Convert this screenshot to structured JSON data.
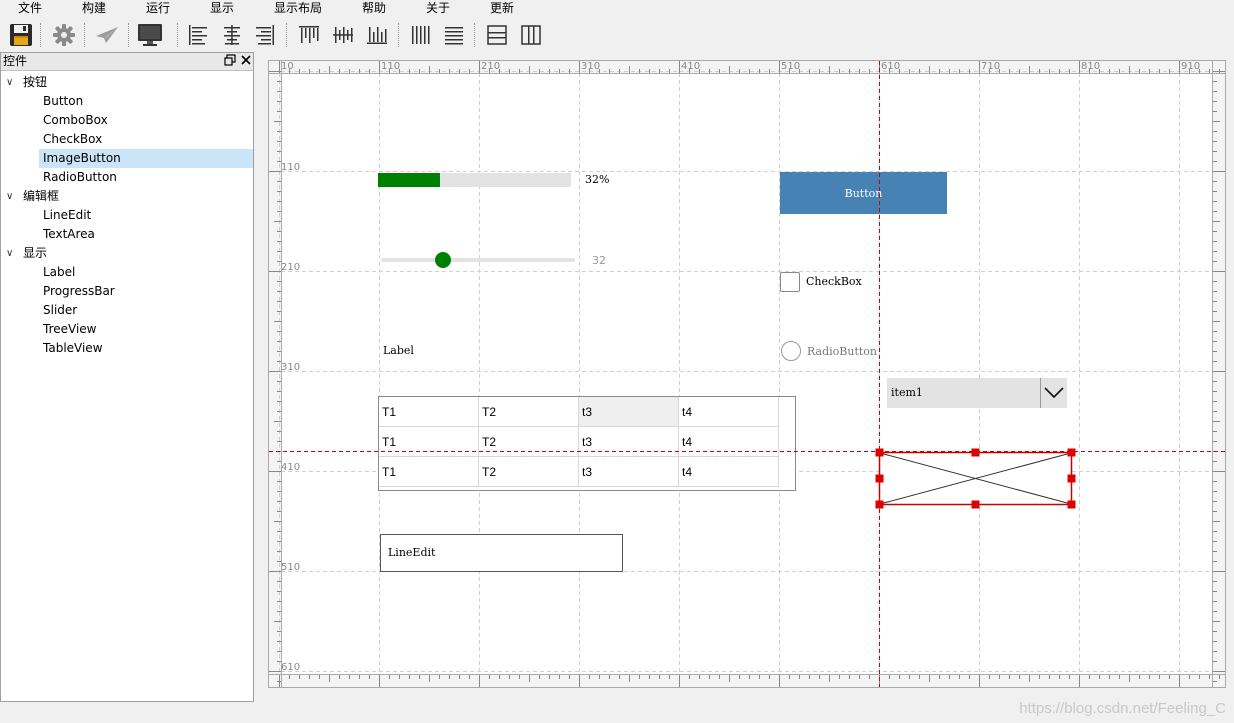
{
  "menu": [
    "文件",
    "构建",
    "运行",
    "显示",
    "显示布局",
    "帮助",
    "关于",
    "更新"
  ],
  "panel": {
    "title": "控件",
    "groups": [
      {
        "label": "按钮",
        "items": [
          "Button",
          "ComboBox",
          "CheckBox",
          "ImageButton",
          "RadioButton"
        ]
      },
      {
        "label": "编辑框",
        "items": [
          "LineEdit",
          "TextArea"
        ]
      },
      {
        "label": "显示",
        "items": [
          "Label",
          "ProgressBar",
          "Slider",
          "TreeView",
          "TableView"
        ]
      }
    ],
    "selected_item": "ImageButton"
  },
  "ruler": {
    "top": [
      "10",
      "110",
      "210",
      "310",
      "410",
      "510",
      "610",
      "710",
      "810",
      "910"
    ],
    "left": [
      "110",
      "210",
      "310",
      "410",
      "510",
      "610"
    ]
  },
  "widgets": {
    "progress": {
      "value": 32,
      "label": "32%"
    },
    "slider": {
      "value": 32,
      "label": "32"
    },
    "label_text": "Label",
    "button_text": "Button",
    "checkbox_text": "CheckBox",
    "radio_text": "RadioButton",
    "combo_value": "item1",
    "table_rows": [
      [
        "T1",
        "T2",
        "t3",
        "t4"
      ],
      [
        "T1",
        "T2",
        "t3",
        "t4"
      ],
      [
        "T1",
        "T2",
        "t3",
        "t4"
      ]
    ],
    "lineedit_value": "LineEdit"
  },
  "watermark": "https://blog.csdn.net/Feeling_C",
  "colors": {
    "accent_green": "#008000",
    "button_blue": "#4682b4",
    "guide_red": "#cc0000",
    "selection_red": "#dd0000"
  }
}
